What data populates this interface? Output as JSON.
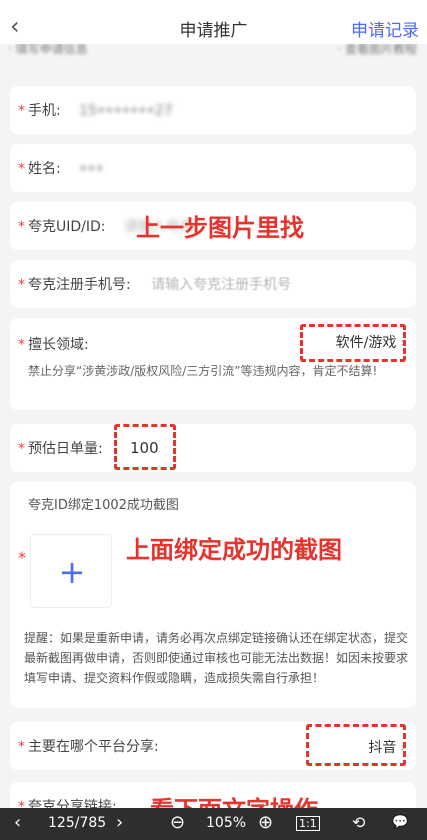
{
  "nav": {
    "back_icon": "‹",
    "title": "申请推广",
    "right_link": "申请记录"
  },
  "peek": {
    "left": "· 填写申请信息",
    "right": "· 查看图片教程"
  },
  "fields": {
    "phone": {
      "label": "手机:",
      "value": "15•••••••27"
    },
    "name": {
      "label": "姓名:",
      "value": "•••"
    },
    "uid": {
      "label": "夸克UID/ID:",
      "placeholder": "请输入夸克",
      "annotation": "上一步图片里找"
    },
    "reg_phone": {
      "label": "夸克注册手机号:",
      "placeholder": "请输入夸克注册手机号"
    },
    "domain": {
      "label": "擅长领域:",
      "value": "软件/游戏",
      "note": "禁止分享“涉黄涉政/版权风险/三方引流”等违规内容，肯定不结算!"
    },
    "estimate": {
      "label": "预估日单量:",
      "value": "100"
    },
    "screenshot": {
      "label": "夸克ID绑定1002成功截图",
      "upload_icon": "+",
      "annotation": "上面绑定成功的截图",
      "tip": "提醒：如果是重新申请，请务必再次点绑定链接确认还在绑定状态，提交最新截图再做申请，否则即使通过审核也可能无法出数据！如因未按要求填写申请、提交资料作假或隐瞒，造成损失需自行承担！"
    },
    "platform": {
      "label": "主要在哪个平台分享:",
      "value": "抖音"
    },
    "share_link": {
      "label": "夸克分享链接:",
      "annotation": "看下面文字操作"
    }
  },
  "viewer": {
    "prev_icon": "‹",
    "page": "125/785",
    "next_icon": "›",
    "zoom_out_icon": "⊖",
    "zoom": "105%",
    "zoom_in_icon": "⊕",
    "actual_size_icon": "1:1",
    "rotate_icon": "⟲",
    "comment_icon": "💬"
  }
}
